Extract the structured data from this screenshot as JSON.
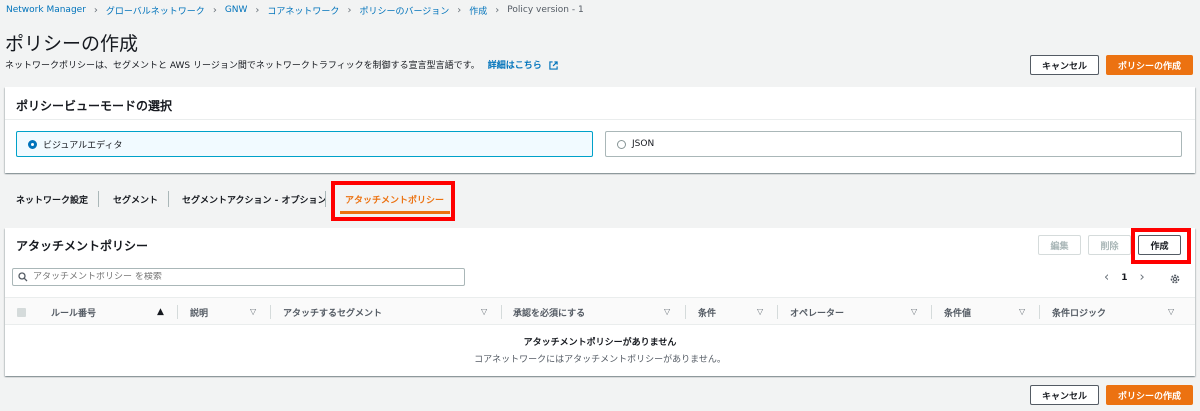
{
  "breadcrumb": [
    "Network Manager",
    "グローバルネットワーク",
    "GNW",
    "コアネットワーク",
    "ポリシーのバージョン",
    "作成",
    "Policy version - 1"
  ],
  "page": {
    "title": "ポリシーの作成",
    "description": "ネットワークポリシーは、セグメントと AWS リージョン間でネットワークトラフィックを制御する宣言型言語です。",
    "details_link": "詳細はこちら"
  },
  "actions": {
    "cancel": "キャンセル",
    "create_policy": "ポリシーの作成"
  },
  "view_mode": {
    "title": "ポリシービューモードの選択",
    "options": [
      {
        "label": "ビジュアルエディタ",
        "selected": true
      },
      {
        "label": "JSON",
        "selected": false
      }
    ]
  },
  "tabs": [
    {
      "label": "ネットワーク設定",
      "active": false
    },
    {
      "label": "セグメント",
      "active": false
    },
    {
      "label": "セグメントアクション - オプション",
      "active": false
    },
    {
      "label": "アタッチメントポリシー",
      "active": true
    }
  ],
  "attachment_panel": {
    "title": "アタッチメントポリシー",
    "buttons": {
      "edit": "編集",
      "delete": "削除",
      "create": "作成"
    },
    "search_placeholder": "アタッチメントポリシー を検索",
    "page_number": "1",
    "columns": [
      "ルール番号",
      "説明",
      "アタッチするセグメント",
      "承認を必須にする",
      "条件",
      "オペレーター",
      "条件値",
      "条件ロジック"
    ],
    "empty_title": "アタッチメントポリシーがありません",
    "empty_message": "コアネットワークにはアタッチメントポリシーがありません。"
  },
  "colors": {
    "link": "#0073bb",
    "primary": "#ec7211",
    "highlight": "#ff0000",
    "selected_border": "#00a1c9"
  }
}
